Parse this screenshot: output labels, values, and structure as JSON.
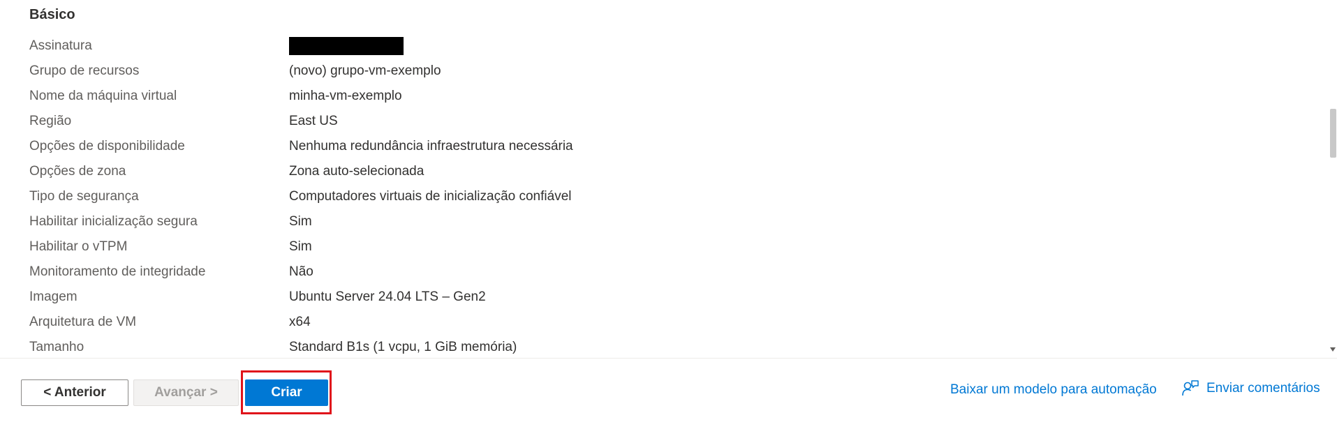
{
  "section": {
    "title": "Básico"
  },
  "rows": [
    {
      "label": "Assinatura",
      "value": "",
      "redacted": true
    },
    {
      "label": "Grupo de recursos",
      "value": "(novo) grupo-vm-exemplo"
    },
    {
      "label": "Nome da máquina virtual",
      "value": "minha-vm-exemplo"
    },
    {
      "label": "Região",
      "value": "East US"
    },
    {
      "label": "Opções de disponibilidade",
      "value": "Nenhuma redundância infraestrutura necessária"
    },
    {
      "label": "Opções de zona",
      "value": "Zona auto-selecionada"
    },
    {
      "label": "Tipo de segurança",
      "value": "Computadores virtuais de inicialização confiável"
    },
    {
      "label": "Habilitar inicialização segura",
      "value": "Sim"
    },
    {
      "label": "Habilitar o vTPM",
      "value": "Sim"
    },
    {
      "label": "Monitoramento de integridade",
      "value": "Não"
    },
    {
      "label": "Imagem",
      "value": "Ubuntu Server 24.04 LTS – Gen2"
    },
    {
      "label": "Arquitetura de VM",
      "value": "x64"
    },
    {
      "label": "Tamanho",
      "value": "Standard B1s (1 vcpu, 1 GiB memória)"
    }
  ],
  "footer": {
    "prev_label": "< Anterior",
    "next_label": "Avançar >",
    "create_label": "Criar",
    "download_link": "Baixar um modelo para automação",
    "feedback_label": "Enviar comentários",
    "feedback_icon": "feedback-person-icon"
  },
  "colors": {
    "accent": "#0078d4",
    "highlight": "#e0141b"
  }
}
